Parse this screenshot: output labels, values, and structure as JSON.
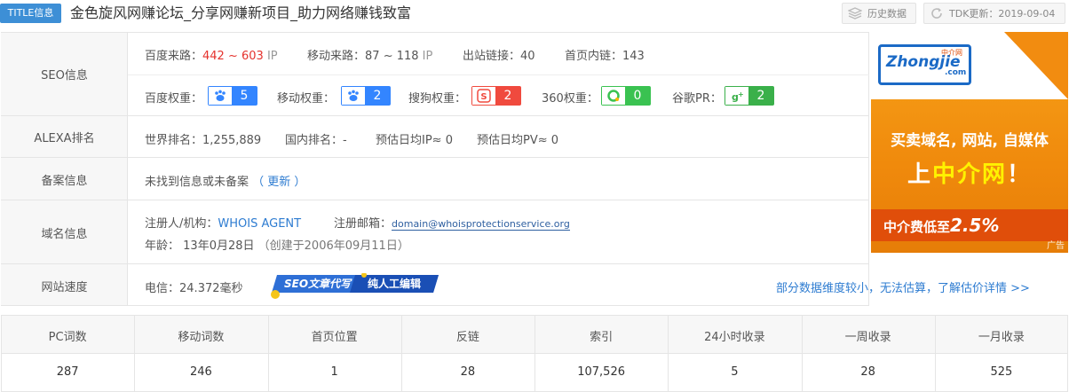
{
  "title": {
    "badge": "TITLE信息",
    "text": "金色旋风网赚论坛_分享网赚新项目_助力网络赚钱致富"
  },
  "toolbar": {
    "history": "历史数据",
    "tdk": "TDK更新：2019-09-04"
  },
  "rows": {
    "seo": {
      "label": "SEO信息",
      "baidu_traffic_label": "百度来路：",
      "baidu_traffic_value": "442 ~ 603",
      "baidu_traffic_unit": "IP",
      "mobile_traffic_label": "移动来路：",
      "mobile_traffic_value": "87 ~ 118",
      "mobile_traffic_unit": "IP",
      "outlinks_label": "出站链接：",
      "outlinks_value": "40",
      "inlinks_label": "首页内链：",
      "inlinks_value": "143",
      "baidu_weight_label": "百度权重：",
      "baidu_weight": "5",
      "mobile_weight_label": "移动权重：",
      "mobile_weight": "2",
      "sogou_weight_label": "搜狗权重：",
      "sogou_weight": "2",
      "so360_weight_label": "360权重：",
      "so360_weight": "0",
      "google_pr_label": "谷歌PR：",
      "google_pr": "2"
    },
    "alexa": {
      "label": "ALEXA排名",
      "world_label": "世界排名：",
      "world_value": "1,255,889",
      "domestic_label": "国内排名：",
      "domestic_value": "-",
      "ip_label": "预估日均IP≈",
      "ip_value": "0",
      "pv_label": "预估日均PV≈",
      "pv_value": "0"
    },
    "icp": {
      "label": "备案信息",
      "text": "未找到信息或未备案",
      "update_link": "（ 更新 ）"
    },
    "domain": {
      "label": "域名信息",
      "registrant_label": "注册人/机构：",
      "registrant_value": "WHOIS AGENT",
      "email_label": "注册邮箱：",
      "email_value": "domain@whoisprotectionservice.org",
      "age_label": "年龄：",
      "age_value": "13年0月28日",
      "created": "（创建于2006年09月11日）"
    },
    "speed": {
      "label": "网站速度",
      "telecom_label": "电信：",
      "telecom_value": "24.372毫秒",
      "banner_left": "SEO文章代写",
      "banner_right": "纯人工编辑",
      "more_link": "部分数据维度较小，无法估算，了解估价详情 >>"
    }
  },
  "ad": {
    "logo": "Zhongjie",
    "logo_sub": "中介网",
    "logo_dot": ".com",
    "line1": "买卖域名, 网站, 自媒体",
    "line2_pre": "上",
    "line2_em": "中介网",
    "line2_post": "！",
    "line3": "中介费低至",
    "line3_pct": "2.5%",
    "tag": "广告"
  },
  "stats": {
    "headers": [
      "PC词数",
      "移动词数",
      "首页位置",
      "反链",
      "索引",
      "24小时收录",
      "一周收录",
      "一月收录"
    ],
    "values": [
      "287",
      "246",
      "1",
      "28",
      "107,526",
      "5",
      "28",
      "525"
    ]
  },
  "colors": {
    "accent": "#3d8fd6",
    "red": "#e5322d",
    "baidu": "#3385ff",
    "sogou": "#f04a3e",
    "so360": "#3ac251",
    "google": "#3ab04a"
  }
}
